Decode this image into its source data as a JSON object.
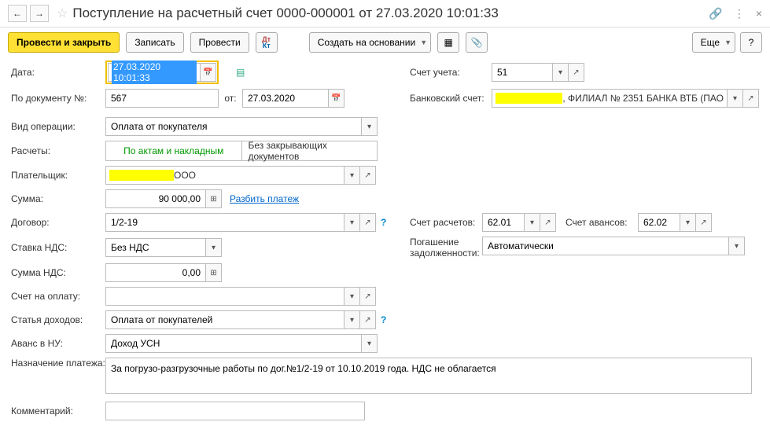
{
  "header": {
    "title": "Поступление на расчетный счет 0000-000001 от 27.03.2020 10:01:33"
  },
  "toolbar": {
    "post_close": "Провести и закрыть",
    "save": "Записать",
    "post": "Провести",
    "create_based": "Создать на основании",
    "more": "Еще"
  },
  "labels": {
    "date": "Дата:",
    "doc_no": "По документу №:",
    "from": "от:",
    "op_type": "Вид операции:",
    "calc": "Расчеты:",
    "payer": "Плательщик:",
    "sum": "Сумма:",
    "split": "Разбить платеж",
    "contract": "Договор:",
    "vat_rate": "Ставка НДС:",
    "vat_sum": "Сумма НДС:",
    "invoice": "Счет на оплату:",
    "income": "Статья доходов:",
    "advance_nu": "Аванс в НУ:",
    "purpose": "Назначение платежа:",
    "comment": "Комментарий:",
    "account": "Счет учета:",
    "bank_account": "Банковский счет:",
    "calc_account": "Счет расчетов:",
    "advance_account": "Счет авансов:",
    "debt": "Погашение задолженности:"
  },
  "values": {
    "date": "27.03.2020 10:01:33",
    "doc_no": "567",
    "doc_date": "27.03.2020",
    "op_type": "Оплата от покупателя",
    "seg_active": "По актам и накладным",
    "seg_inactive": "Без закрывающих документов",
    "payer_suffix": "ООО",
    "sum": "90 000,00",
    "contract": "1/2-19",
    "vat_rate": "Без НДС",
    "vat_sum": "0,00",
    "income": "Оплата от покупателей",
    "advance_nu": "Доход УСН",
    "purpose": "За погрузо-разгрузочные работы по дог.№1/2-19 от 10.10.2019 года. НДС не облагается",
    "account": "51",
    "bank_account_suffix": ", ФИЛИАЛ № 2351 БАНКА ВТБ (ПАО",
    "calc_account": "62.01",
    "advance_account": "62.02",
    "debt": "Автоматически"
  }
}
